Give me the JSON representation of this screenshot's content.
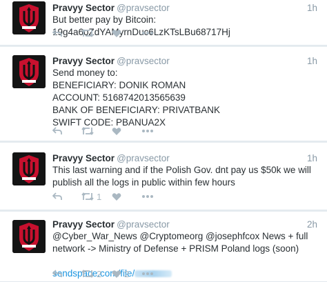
{
  "tweets": [
    {
      "name": "Pravyy Sector",
      "handle": "@pravsector",
      "time": "1h",
      "text": "But better pay by Bitcoin: 19g4a6oZdYAMyrnDuc6LzKTsLBu68717Hj",
      "retweets": "",
      "likes": ""
    },
    {
      "name": "Pravyy Sector",
      "handle": "@pravsector",
      "time": "1h",
      "text": "Send money to:\nBENEFICIARY: DONIK ROMAN\nACCOUNT: 5168742013565639\nBANK OF BENEFICIARY: PRIVATBANK\nSWIFT CODE: PBANUA2X",
      "retweets": "",
      "likes": ""
    },
    {
      "name": "Pravyy Sector",
      "handle": "@pravsector",
      "time": "1h",
      "text": "This last warning and if the Polish Gov. dnt pay us $50k we will publish all the logs in public within few hours",
      "retweets": "1",
      "likes": ""
    },
    {
      "name": "Pravyy Sector",
      "handle": "@pravsector",
      "time": "2h",
      "text": "@Cyber_War_News @Cryptomeorg @josephfcox News + full network -> Ministry of Defense + PRISM Poland logs (soon)",
      "link": "sendspace.com/file/",
      "retweets": "2",
      "likes": "2"
    }
  ],
  "icons": {
    "reply": "reply-icon",
    "retweet": "retweet-icon",
    "like": "heart-icon",
    "more": "more-icon",
    "avatar": "trident-shield-logo"
  },
  "colors": {
    "link": "#1b95e0",
    "muted": "#8899a6",
    "action": "#aab8c2",
    "avatar_red": "#c8102e"
  }
}
